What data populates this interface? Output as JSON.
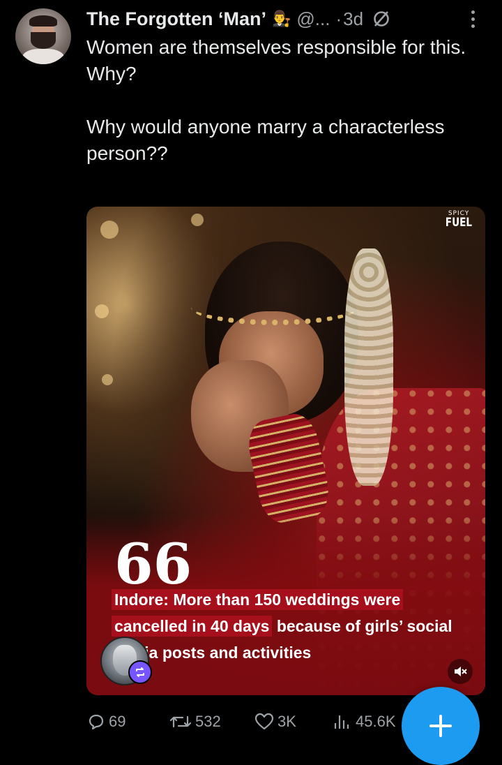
{
  "post": {
    "author_name": "The Forgotten ‘Man’",
    "author_emoji": "👨‍⚖️",
    "handle": "@...",
    "separator": "·",
    "time": "3d",
    "text": "Women are themselves responsible for this.\nWhy?\n\nWhy would anyone marry a characterless person??"
  },
  "media": {
    "brand_small": "SPICY",
    "brand_big": "FUEL",
    "quote_mark": "66",
    "headline_part1": "Indore: More than 150 weddings were cancelled in 40 days",
    "headline_part2": " because of girls’ social media posts and activities"
  },
  "actions": {
    "replies": "69",
    "reposts": "532",
    "likes": "3K",
    "views": "45.6K"
  },
  "fab": {
    "label": "+"
  },
  "colors": {
    "background": "#000000",
    "text": "#e7e9ea",
    "muted": "#9ea3a8",
    "accent_blue": "#1d9bf0",
    "repost_purple": "#7856ff",
    "headline_highlight": "#a5101c"
  }
}
